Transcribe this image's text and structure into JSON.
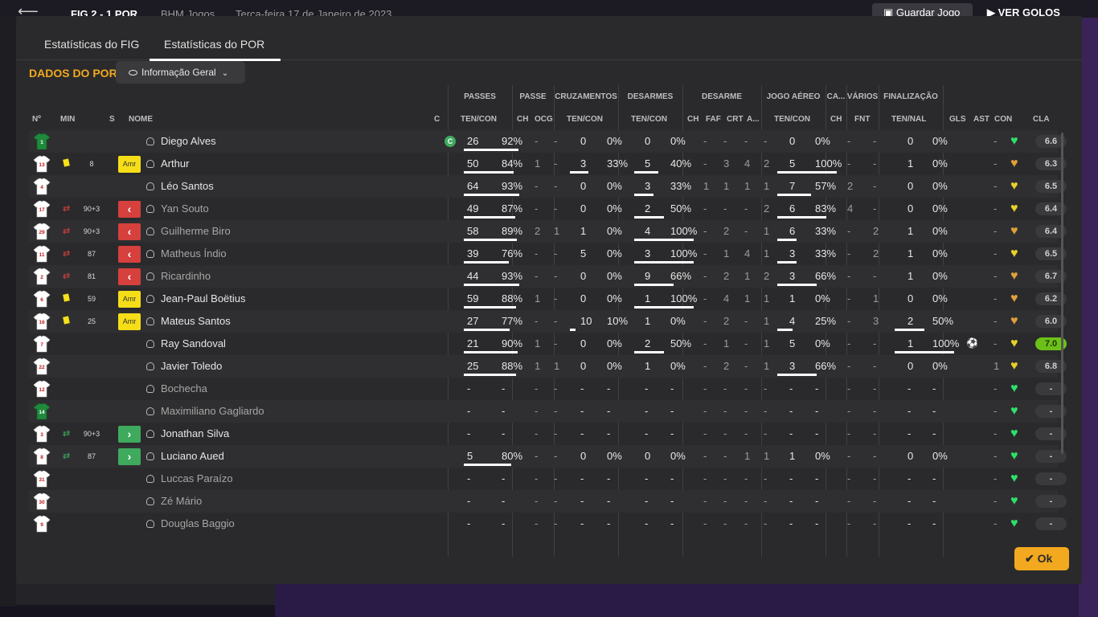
{
  "topbar": {
    "back_label": "⟵",
    "score": "FIG  2 - 1  POR",
    "competition": "BHM Jogos",
    "date": "Terça-feira 17 de Janeiro de 2023",
    "save_label": "Guardar Jogo",
    "goals_label": "VER GOLOS"
  },
  "tabs": {
    "fig": "Estatísticas do FIG",
    "por": "Estatísticas do POR"
  },
  "section": {
    "title": "DADOS DO POR",
    "dropdown": "Informação Geral"
  },
  "groups": {
    "passes": "PASSES",
    "passe": "PASSE",
    "cruzamentos": "CRUZAMENTOS",
    "desarmes": "DESARMES",
    "desarme": "DESARME",
    "jogo_aereo": "JOGO AÉREO",
    "ca": "CA...",
    "varios": "VÁRIOS",
    "finalizacao": "FINALIZAÇÃO"
  },
  "headers": {
    "num": "Nº",
    "min": "MIN",
    "s": "S",
    "nome": "NOME",
    "c": "C",
    "passes_tc": "TEN/CON",
    "passe_ch": "CH",
    "passe_ocg": "OCG",
    "cruz_tc": "TEN/CON",
    "des_tc": "TEN/CON",
    "des_ch": "CH",
    "des_faf": "FAF",
    "des_crt": "CRT",
    "des_a": "A...",
    "aereo_tc": "TEN/CON",
    "ca_ch": "CH",
    "varios_fnt": "FNT",
    "fin_tn": "TEN/NAL",
    "gls": "GLS",
    "ast": "AST",
    "con": "CON",
    "cla": "CLA"
  },
  "captain_badge": "C",
  "ok_label": "Ok",
  "colors": {
    "accent": "#f2a81f",
    "card_yellow": "#f5de18",
    "sub_out": "#d6403d",
    "sub_in": "#3fa95e",
    "heart_green": "#2ee06a",
    "heart_yellow": "#e8d22a",
    "heart_orange": "#e0a03a"
  },
  "players": [
    {
      "num": "1",
      "gk": true,
      "card": false,
      "sub": "",
      "min": "",
      "status": "",
      "name": "Diego Alves",
      "dim": false,
      "captain": true,
      "pt": "26",
      "pp": "92%",
      "pch": "-",
      "pocg": "-",
      "ct": "0",
      "cp": "0%",
      "dt": "0",
      "dp": "0%",
      "dch": "-",
      "dfaf": "-",
      "dcrt": "-",
      "da": "-",
      "at": "0",
      "ap": "0%",
      "cach": "-",
      "fnt": "-",
      "ft": "0",
      "fp": "0%",
      "gls": "",
      "ast": "-",
      "heart": "green",
      "rating": "6.6",
      "top": false
    },
    {
      "num": "13",
      "gk": false,
      "card": true,
      "sub": "",
      "min": "8",
      "status": "Amr",
      "name": "Arthur",
      "dim": false,
      "captain": false,
      "pt": "50",
      "pp": "84%",
      "pch": "1",
      "pocg": "-",
      "ct": "3",
      "cp": "33%",
      "dt": "5",
      "dp": "40%",
      "dch": "-",
      "dfaf": "3",
      "dcrt": "4",
      "da": "2",
      "at": "5",
      "ap": "100%",
      "cach": "-",
      "fnt": "-",
      "ft": "1",
      "fp": "0%",
      "gls": "",
      "ast": "-",
      "heart": "orange",
      "rating": "6.3",
      "top": false
    },
    {
      "num": "4",
      "gk": false,
      "card": false,
      "sub": "",
      "min": "",
      "status": "",
      "name": "Léo Santos",
      "dim": false,
      "captain": false,
      "pt": "64",
      "pp": "93%",
      "pch": "-",
      "pocg": "-",
      "ct": "0",
      "cp": "0%",
      "dt": "3",
      "dp": "33%",
      "dch": "1",
      "dfaf": "1",
      "dcrt": "1",
      "da": "1",
      "at": "7",
      "ap": "57%",
      "cach": "2",
      "fnt": "-",
      "ft": "0",
      "fp": "0%",
      "gls": "",
      "ast": "-",
      "heart": "yellow",
      "rating": "6.5",
      "top": false
    },
    {
      "num": "17",
      "gk": false,
      "card": false,
      "sub": "out",
      "min": "90+3",
      "status": "out",
      "name": "Yan Souto",
      "dim": true,
      "captain": false,
      "pt": "49",
      "pp": "87%",
      "pch": "-",
      "pocg": "-",
      "ct": "0",
      "cp": "0%",
      "dt": "2",
      "dp": "50%",
      "dch": "-",
      "dfaf": "-",
      "dcrt": "-",
      "da": "2",
      "at": "6",
      "ap": "83%",
      "cach": "4",
      "fnt": "-",
      "ft": "0",
      "fp": "0%",
      "gls": "",
      "ast": "-",
      "heart": "yellow",
      "rating": "6.4",
      "top": false
    },
    {
      "num": "29",
      "gk": false,
      "card": false,
      "sub": "out",
      "min": "90+3",
      "status": "out",
      "name": "Guilherme Biro",
      "dim": true,
      "captain": false,
      "pt": "58",
      "pp": "89%",
      "pch": "2",
      "pocg": "1",
      "ct": "1",
      "cp": "0%",
      "dt": "4",
      "dp": "100%",
      "dch": "-",
      "dfaf": "2",
      "dcrt": "-",
      "da": "1",
      "at": "6",
      "ap": "33%",
      "cach": "-",
      "fnt": "2",
      "ft": "1",
      "fp": "0%",
      "gls": "",
      "ast": "-",
      "heart": "orange",
      "rating": "6.4",
      "top": false
    },
    {
      "num": "11",
      "gk": false,
      "card": false,
      "sub": "out",
      "min": "87",
      "status": "out",
      "name": "Matheus Índio",
      "dim": true,
      "captain": false,
      "pt": "39",
      "pp": "76%",
      "pch": "-",
      "pocg": "-",
      "ct": "5",
      "cp": "0%",
      "dt": "3",
      "dp": "100%",
      "dch": "-",
      "dfaf": "1",
      "dcrt": "4",
      "da": "1",
      "at": "3",
      "ap": "33%",
      "cach": "-",
      "fnt": "2",
      "ft": "1",
      "fp": "0%",
      "gls": "",
      "ast": "-",
      "heart": "yellow",
      "rating": "6.5",
      "top": false
    },
    {
      "num": "2",
      "gk": false,
      "card": false,
      "sub": "out",
      "min": "81",
      "status": "out",
      "name": "Ricardinho",
      "dim": true,
      "captain": false,
      "pt": "44",
      "pp": "93%",
      "pch": "-",
      "pocg": "-",
      "ct": "0",
      "cp": "0%",
      "dt": "9",
      "dp": "66%",
      "dch": "-",
      "dfaf": "2",
      "dcrt": "1",
      "da": "2",
      "at": "3",
      "ap": "66%",
      "cach": "-",
      "fnt": "-",
      "ft": "1",
      "fp": "0%",
      "gls": "",
      "ast": "-",
      "heart": "orange",
      "rating": "6.7",
      "top": false
    },
    {
      "num": "6",
      "gk": false,
      "card": true,
      "sub": "",
      "min": "59",
      "status": "Amr",
      "name": "Jean-Paul Boëtius",
      "dim": false,
      "captain": false,
      "pt": "59",
      "pp": "88%",
      "pch": "1",
      "pocg": "-",
      "ct": "0",
      "cp": "0%",
      "dt": "1",
      "dp": "100%",
      "dch": "-",
      "dfaf": "4",
      "dcrt": "1",
      "da": "1",
      "at": "1",
      "ap": "0%",
      "cach": "-",
      "fnt": "1",
      "ft": "0",
      "fp": "0%",
      "gls": "",
      "ast": "-",
      "heart": "orange",
      "rating": "6.2",
      "top": false
    },
    {
      "num": "16",
      "gk": false,
      "card": true,
      "sub": "",
      "min": "25",
      "status": "Amr",
      "name": "Mateus Santos",
      "dim": false,
      "captain": false,
      "pt": "27",
      "pp": "77%",
      "pch": "-",
      "pocg": "-",
      "ct": "10",
      "cp": "10%",
      "dt": "1",
      "dp": "0%",
      "dch": "-",
      "dfaf": "2",
      "dcrt": "-",
      "da": "1",
      "at": "4",
      "ap": "25%",
      "cach": "-",
      "fnt": "3",
      "ft": "2",
      "fp": "50%",
      "gls": "",
      "ast": "-",
      "heart": "orange",
      "rating": "6.0",
      "top": false
    },
    {
      "num": "7",
      "gk": false,
      "card": false,
      "sub": "",
      "min": "",
      "status": "",
      "name": "Ray Sandoval",
      "dim": false,
      "captain": false,
      "pt": "21",
      "pp": "90%",
      "pch": "1",
      "pocg": "-",
      "ct": "0",
      "cp": "0%",
      "dt": "2",
      "dp": "50%",
      "dch": "-",
      "dfaf": "1",
      "dcrt": "-",
      "da": "1",
      "at": "5",
      "ap": "0%",
      "cach": "-",
      "fnt": "-",
      "ft": "1",
      "fp": "100%",
      "gls": "⚽",
      "ast": "-",
      "heart": "yellow",
      "rating": "7.0",
      "top": true
    },
    {
      "num": "22",
      "gk": false,
      "card": false,
      "sub": "",
      "min": "",
      "status": "",
      "name": "Javier Toledo",
      "dim": false,
      "captain": false,
      "pt": "25",
      "pp": "88%",
      "pch": "1",
      "pocg": "1",
      "ct": "0",
      "cp": "0%",
      "dt": "1",
      "dp": "0%",
      "dch": "-",
      "dfaf": "2",
      "dcrt": "-",
      "da": "1",
      "at": "3",
      "ap": "66%",
      "cach": "-",
      "fnt": "-",
      "ft": "0",
      "fp": "0%",
      "gls": "",
      "ast": "1",
      "heart": "yellow",
      "rating": "6.8",
      "top": false
    },
    {
      "num": "12",
      "gk": false,
      "card": false,
      "sub": "",
      "min": "",
      "status": "",
      "name": "Bochecha",
      "dim": true,
      "captain": false,
      "pt": "-",
      "pp": "-",
      "pch": "-",
      "pocg": "-",
      "ct": "-",
      "cp": "-",
      "dt": "-",
      "dp": "-",
      "dch": "-",
      "dfaf": "-",
      "dcrt": "-",
      "da": "-",
      "at": "-",
      "ap": "-",
      "cach": "-",
      "fnt": "-",
      "ft": "-",
      "fp": "-",
      "gls": "",
      "ast": "-",
      "heart": "green",
      "rating": "-",
      "top": false
    },
    {
      "num": "14",
      "gk": true,
      "card": false,
      "sub": "",
      "min": "",
      "status": "",
      "name": "Maximiliano Gagliardo",
      "dim": true,
      "captain": false,
      "pt": "-",
      "pp": "-",
      "pch": "-",
      "pocg": "-",
      "ct": "-",
      "cp": "-",
      "dt": "-",
      "dp": "-",
      "dch": "-",
      "dfaf": "-",
      "dcrt": "-",
      "da": "-",
      "at": "-",
      "ap": "-",
      "cach": "-",
      "fnt": "-",
      "ft": "-",
      "fp": "-",
      "gls": "",
      "ast": "-",
      "heart": "green",
      "rating": "-",
      "top": false
    },
    {
      "num": "3",
      "gk": false,
      "card": false,
      "sub": "in",
      "min": "90+3",
      "status": "in",
      "name": "Jonathan Silva",
      "dim": false,
      "captain": false,
      "pt": "-",
      "pp": "-",
      "pch": "-",
      "pocg": "-",
      "ct": "-",
      "cp": "-",
      "dt": "-",
      "dp": "-",
      "dch": "-",
      "dfaf": "-",
      "dcrt": "-",
      "da": "-",
      "at": "-",
      "ap": "-",
      "cach": "-",
      "fnt": "-",
      "ft": "-",
      "fp": "-",
      "gls": "",
      "ast": "-",
      "heart": "green",
      "rating": "-",
      "top": false
    },
    {
      "num": "8",
      "gk": false,
      "card": false,
      "sub": "in",
      "min": "87",
      "status": "in",
      "name": "Luciano Aued",
      "dim": false,
      "captain": false,
      "pt": "5",
      "pp": "80%",
      "pch": "-",
      "pocg": "-",
      "ct": "0",
      "cp": "0%",
      "dt": "0",
      "dp": "0%",
      "dch": "-",
      "dfaf": "-",
      "dcrt": "1",
      "da": "1",
      "at": "1",
      "ap": "0%",
      "cach": "-",
      "fnt": "-",
      "ft": "0",
      "fp": "0%",
      "gls": "",
      "ast": "-",
      "heart": "green",
      "rating": "-",
      "top": false
    },
    {
      "num": "31",
      "gk": false,
      "card": false,
      "sub": "",
      "min": "",
      "status": "",
      "name": "Luccas Paraízo",
      "dim": true,
      "captain": false,
      "pt": "-",
      "pp": "-",
      "pch": "-",
      "pocg": "-",
      "ct": "-",
      "cp": "-",
      "dt": "-",
      "dp": "-",
      "dch": "-",
      "dfaf": "-",
      "dcrt": "-",
      "da": "-",
      "at": "-",
      "ap": "-",
      "cach": "-",
      "fnt": "-",
      "ft": "-",
      "fp": "-",
      "gls": "",
      "ast": "-",
      "heart": "green",
      "rating": "-",
      "top": false
    },
    {
      "num": "30",
      "gk": false,
      "card": false,
      "sub": "",
      "min": "",
      "status": "",
      "name": "Zé Mário",
      "dim": true,
      "captain": false,
      "pt": "-",
      "pp": "-",
      "pch": "-",
      "pocg": "-",
      "ct": "-",
      "cp": "-",
      "dt": "-",
      "dp": "-",
      "dch": "-",
      "dfaf": "-",
      "dcrt": "-",
      "da": "-",
      "at": "-",
      "ap": "-",
      "cach": "-",
      "fnt": "-",
      "ft": "-",
      "fp": "-",
      "gls": "",
      "ast": "-",
      "heart": "green",
      "rating": "-",
      "top": false
    },
    {
      "num": "9",
      "gk": false,
      "card": false,
      "sub": "",
      "min": "",
      "status": "",
      "name": "Douglas Baggio",
      "dim": true,
      "captain": false,
      "pt": "-",
      "pp": "-",
      "pch": "-",
      "pocg": "-",
      "ct": "-",
      "cp": "-",
      "dt": "-",
      "dp": "-",
      "dch": "-",
      "dfaf": "-",
      "dcrt": "-",
      "da": "-",
      "at": "-",
      "ap": "-",
      "cach": "-",
      "fnt": "-",
      "ft": "-",
      "fp": "-",
      "gls": "",
      "ast": "-",
      "heart": "green",
      "rating": "-",
      "top": false
    }
  ]
}
